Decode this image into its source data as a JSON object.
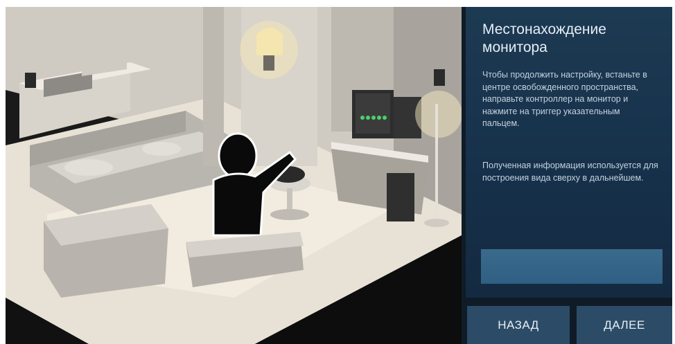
{
  "panel": {
    "title": "Местонахождение монитора",
    "paragraph1": "Чтобы продолжить настройку, встаньте в центре освобожденного пространства, направьте контроллер на монитор и нажмите на триггер указательным пальцем.",
    "paragraph2": "Полученная информация используется для построения вида сверху в дальнейшем."
  },
  "buttons": {
    "back_label": "НАЗАД",
    "next_label": "ДАЛЕЕ"
  },
  "colors": {
    "panel_bg": "#1d3a53",
    "button_bg": "#2c4b66",
    "progress_bar": "#3a6a8c",
    "monitor_indicator": "#4ccf6a"
  }
}
